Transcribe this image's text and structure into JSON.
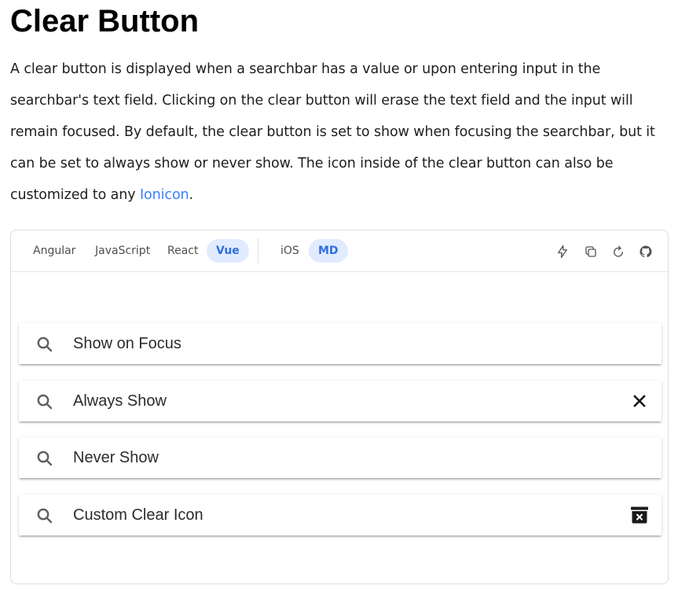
{
  "page": {
    "title": "Clear Button",
    "intro_text": "A clear button is displayed when a searchbar has a value or upon entering input in the searchbar's text field. Clicking on the clear button will erase the text field and the input will remain focused. By default, the clear button is set to show when focusing the searchbar, but it can be set to always show or never show. The icon inside of the clear button can also be customized to any ",
    "intro_link": "Ionicon",
    "intro_end": "."
  },
  "playground": {
    "framework_tabs": [
      {
        "label": "Angular",
        "active": false
      },
      {
        "label": "JavaScript",
        "active": false
      },
      {
        "label": "React",
        "active": false
      },
      {
        "label": "Vue",
        "active": true
      }
    ],
    "mode_tabs": [
      {
        "label": "iOS",
        "active": false
      },
      {
        "label": "MD",
        "active": true
      }
    ],
    "tools": [
      "bolt-icon",
      "copy-icon",
      "reload-icon",
      "github-icon"
    ],
    "searchbars": [
      {
        "placeholder": "Show on Focus",
        "clear_icon": null
      },
      {
        "placeholder": "Always Show",
        "clear_icon": "close-icon"
      },
      {
        "placeholder": "Never Show",
        "clear_icon": null
      },
      {
        "placeholder": "Custom Clear Icon",
        "clear_icon": "trash-bin-icon"
      }
    ]
  },
  "colors": {
    "link": "#3880ff",
    "active_tab_bg": "#e1ebff",
    "active_tab_text": "#2f6fe0"
  }
}
